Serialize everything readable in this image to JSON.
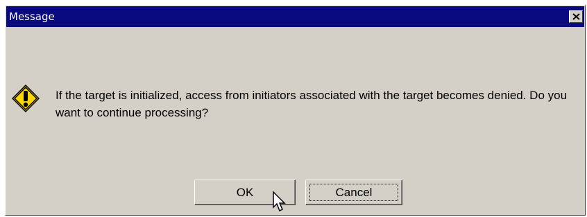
{
  "window": {
    "title": "Message"
  },
  "message": {
    "text": "If the target is initialized, access from initiators associated with the target becomes denied. Do you want to continue processing?",
    "icon": "warning-icon"
  },
  "buttons": {
    "ok_label": "OK",
    "cancel_label": "Cancel",
    "focused": "cancel"
  },
  "icons": {
    "close": "close-icon",
    "cursor": "mouse-pointer-icon"
  },
  "colors": {
    "titlebar": "#0a0a80",
    "face": "#d4d0c8",
    "warning_fill": "#ffd700"
  }
}
